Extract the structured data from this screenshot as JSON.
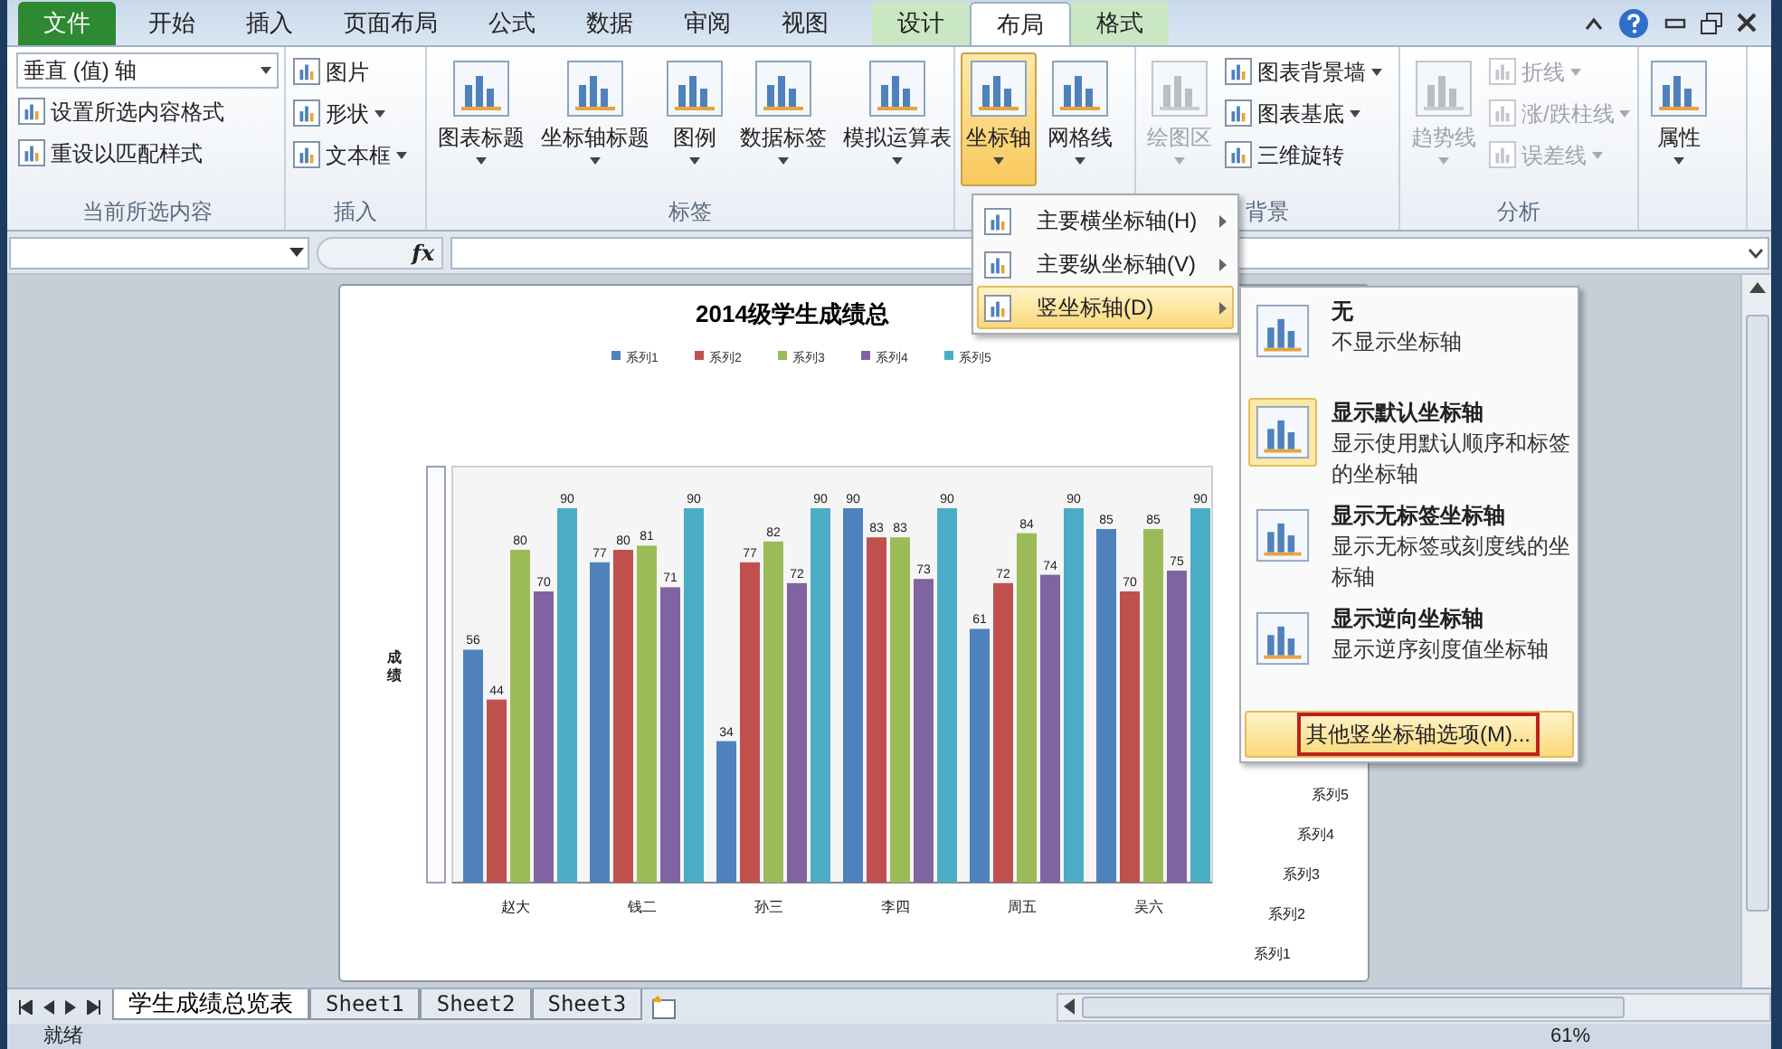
{
  "tabs": [
    {
      "label": "文件",
      "kind": "file",
      "selected": false
    },
    {
      "label": "开始",
      "kind": "normal",
      "selected": false
    },
    {
      "label": "插入",
      "kind": "normal",
      "selected": false
    },
    {
      "label": "页面布局",
      "kind": "normal",
      "selected": false
    },
    {
      "label": "公式",
      "kind": "normal",
      "selected": false
    },
    {
      "label": "数据",
      "kind": "normal",
      "selected": false
    },
    {
      "label": "审阅",
      "kind": "normal",
      "selected": false
    },
    {
      "label": "视图",
      "kind": "normal",
      "selected": false
    },
    {
      "label": "设计",
      "kind": "context",
      "selected": false
    },
    {
      "label": "布局",
      "kind": "context",
      "selected": true
    },
    {
      "label": "格式",
      "kind": "context",
      "selected": false
    }
  ],
  "ribbon_groups": [
    {
      "label": "当前所选内容",
      "items": [
        {
          "kind": "dropdown",
          "label": "垂直 (值) 轴",
          "disabled": false
        },
        {
          "kind": "small",
          "label": "设置所选内容格式",
          "disabled": false,
          "caret": false
        },
        {
          "kind": "small",
          "label": "重设以匹配样式",
          "disabled": false,
          "caret": false
        }
      ]
    },
    {
      "label": "插入",
      "items": [
        {
          "kind": "small",
          "label": "图片",
          "disabled": false,
          "caret": false
        },
        {
          "kind": "small",
          "label": "形状",
          "disabled": false,
          "caret": true
        },
        {
          "kind": "small",
          "label": "文本框",
          "disabled": false,
          "caret": true
        }
      ]
    },
    {
      "label": "标签",
      "items": [
        {
          "kind": "large",
          "label": "图表标题",
          "disabled": false,
          "pressed": false
        },
        {
          "kind": "large",
          "label": "坐标轴标题",
          "disabled": false,
          "pressed": false
        },
        {
          "kind": "large",
          "label": "图例",
          "disabled": false,
          "pressed": false
        },
        {
          "kind": "large",
          "label": "数据标签",
          "disabled": false,
          "pressed": false
        },
        {
          "kind": "large",
          "label": "模拟运算表",
          "disabled": false,
          "pressed": false
        }
      ]
    },
    {
      "items": [
        {
          "kind": "large",
          "label": "坐标轴",
          "disabled": false,
          "pressed": true
        },
        {
          "kind": "large",
          "label": "网格线",
          "disabled": false,
          "pressed": false
        }
      ]
    },
    {
      "label": "背景",
      "items": [
        {
          "kind": "large",
          "label": "绘图区",
          "disabled": true,
          "pressed": false
        },
        {
          "kind": "small",
          "label": "图表背景墙",
          "disabled": false,
          "caret": true
        },
        {
          "kind": "small",
          "label": "图表基底",
          "disabled": false,
          "caret": true
        },
        {
          "kind": "small",
          "label": "三维旋转",
          "disabled": false,
          "caret": false
        }
      ]
    },
    {
      "label": "分析",
      "items": [
        {
          "kind": "large",
          "label": "趋势线",
          "disabled": true,
          "pressed": false
        },
        {
          "kind": "small",
          "label": "折线",
          "disabled": true,
          "caret": true
        },
        {
          "kind": "small",
          "label": "涨/跌柱线",
          "disabled": true,
          "caret": true
        },
        {
          "kind": "small",
          "label": "误差线",
          "disabled": true,
          "caret": true
        }
      ]
    },
    {
      "items": [
        {
          "kind": "large",
          "label": "属性",
          "disabled": false,
          "pressed": false
        }
      ]
    }
  ],
  "chart": {
    "chart_data": {
      "type": "bar",
      "title": "2014级学生成绩总",
      "ylabel": "成绩",
      "categories": [
        "赵大",
        "钱二",
        "孙三",
        "李四",
        "周五",
        "吴六"
      ],
      "data_labels": true,
      "legend": true,
      "series": [
        {
          "name": "系列1",
          "color": "#4f81bd",
          "values": [
            56,
            77,
            34,
            90,
            61,
            85
          ]
        },
        {
          "name": "系列2",
          "color": "#c0504d",
          "values": [
            44,
            80,
            77,
            83,
            72,
            70
          ]
        },
        {
          "name": "系列3",
          "color": "#9bbb59",
          "values": [
            80,
            81,
            82,
            83,
            84,
            85
          ]
        },
        {
          "name": "系列4",
          "color": "#8064a2",
          "values": [
            70,
            71,
            72,
            73,
            74,
            75
          ]
        },
        {
          "name": "系列5",
          "color": "#4bacc6",
          "values": [
            90,
            90,
            90,
            90,
            90,
            90
          ]
        }
      ]
    },
    "depth_labels": [
      "系列1",
      "系列2",
      "系列3",
      "系列4",
      "系列5"
    ]
  },
  "axis_menu": [
    {
      "label": "主要横坐标轴(H)",
      "selected": false
    },
    {
      "label": "主要纵坐标轴(V)",
      "selected": false
    },
    {
      "label": "竖坐标轴(D)",
      "selected": true
    }
  ],
  "axis_submenu": {
    "options": [
      {
        "title": "无",
        "description": "不显示坐标轴",
        "selected": false
      },
      {
        "title": "显示默认坐标轴",
        "description": "显示使用默认顺序和标签的坐标轴",
        "selected": true
      },
      {
        "title": "显示无标签坐标轴",
        "description": "显示无标签或刻度线的坐标轴",
        "selected": false
      },
      {
        "title": "显示逆向坐标轴",
        "description": "显示逆序刻度值坐标轴",
        "selected": false
      }
    ],
    "more": {
      "label": "其他竖坐标轴选项(M)...",
      "outlined": true
    }
  },
  "sheet_tabs": [
    {
      "label": "学生成绩总览表",
      "selected": true
    },
    {
      "label": "Sheet1",
      "selected": false
    },
    {
      "label": "Sheet2",
      "selected": false
    },
    {
      "label": "Sheet3",
      "selected": false
    }
  ],
  "formula_bar": {
    "function_label": "fx"
  },
  "status_bar": {
    "status": "就绪",
    "zoom": "61%"
  }
}
